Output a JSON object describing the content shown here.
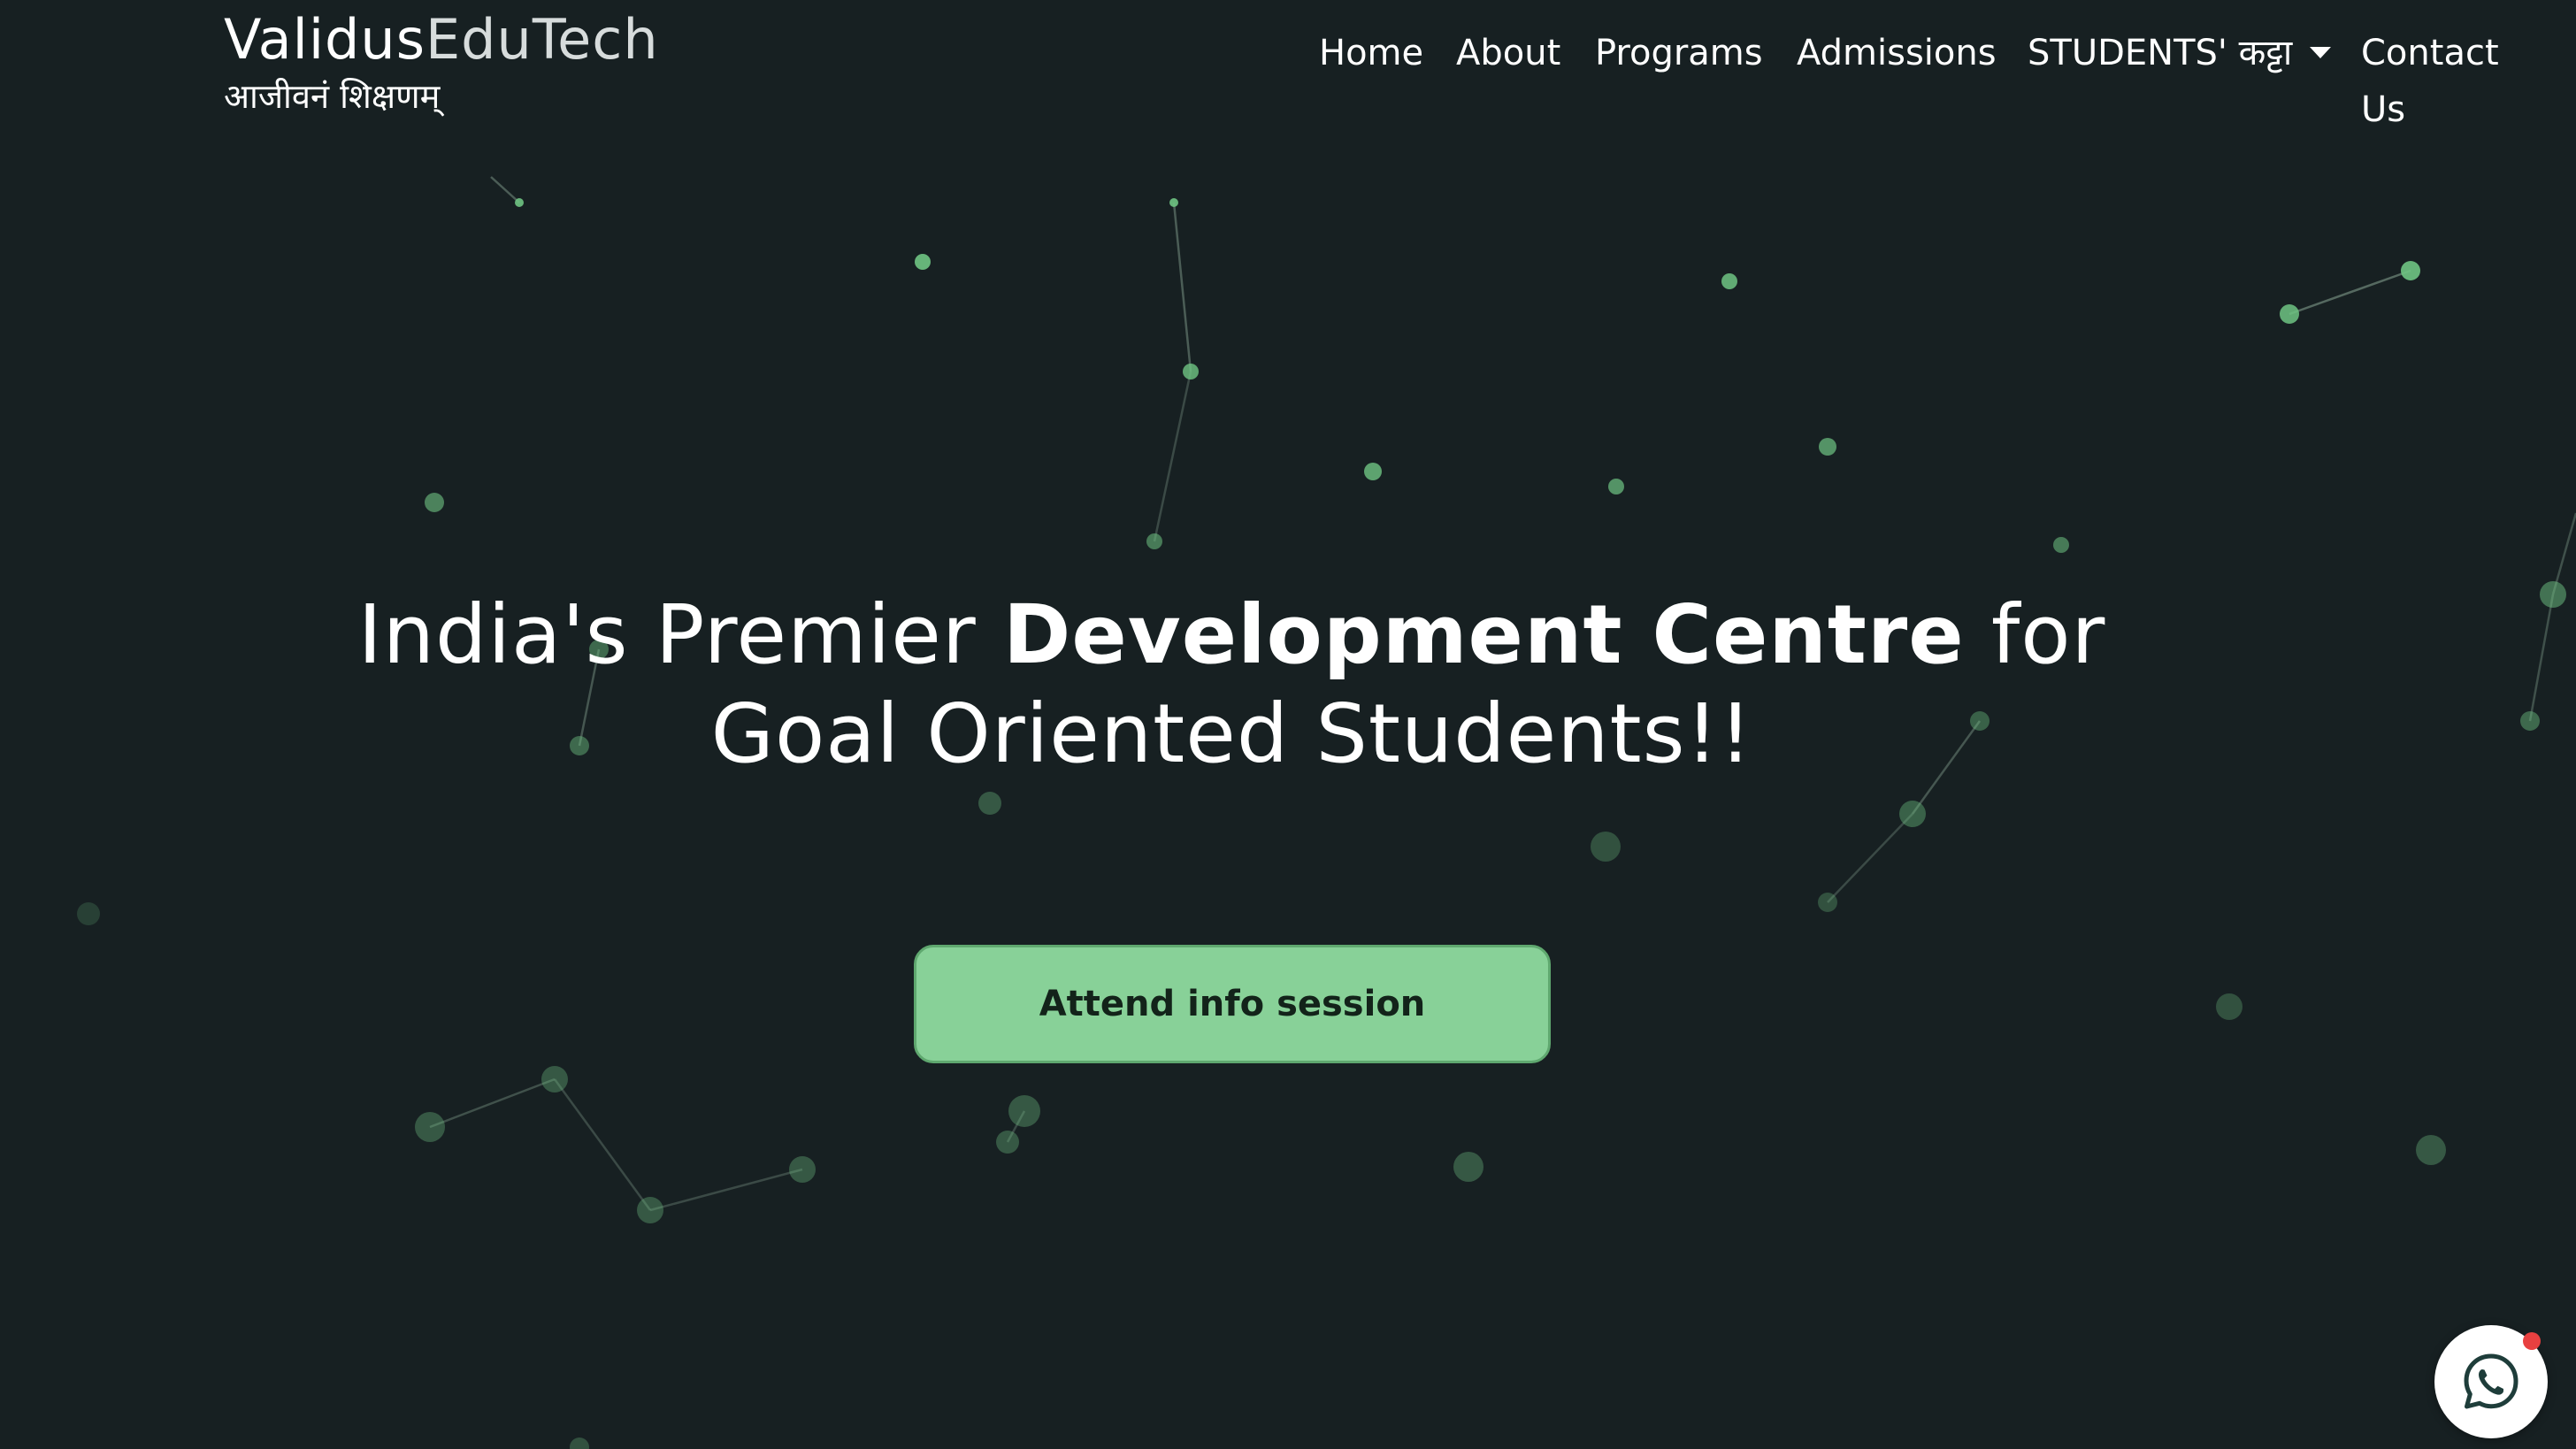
{
  "header": {
    "brand": {
      "name_primary": "Validus",
      "name_secondary": "EduTech",
      "tagline": "आजीवनं शिक्षणम्"
    },
    "nav": {
      "items": [
        {
          "label": "Home"
        },
        {
          "label": "About"
        },
        {
          "label": "Programs"
        },
        {
          "label": "Admissions"
        },
        {
          "label": "STUDENTS' कट्टा",
          "dropdown": true,
          "icon": "caret-down-icon"
        },
        {
          "label": "Contact"
        }
      ],
      "contact_line2": "Us"
    }
  },
  "hero": {
    "title_part1": "India's Premier ",
    "title_bold": "Development Centre",
    "title_part2": " for",
    "title_line2": "Goal Oriented Students!!",
    "cta_label": "Attend info session"
  },
  "floating": {
    "chat_icon": "whatsapp-icon",
    "notification": "red-dot"
  },
  "colors": {
    "background": "#172022",
    "accent": "#88d198",
    "particle": "#6fc483",
    "badge": "#e84040"
  }
}
